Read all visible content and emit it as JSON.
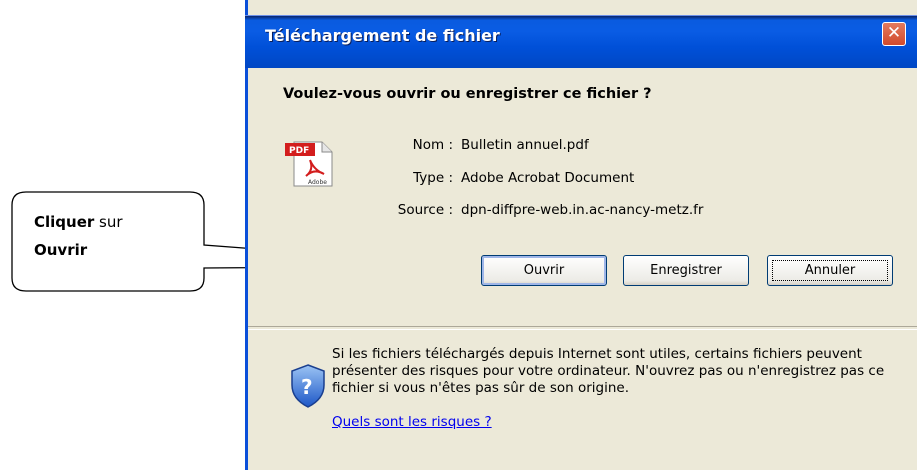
{
  "dialog": {
    "title": "Téléchargement de fichier",
    "close_glyph": "✕",
    "question": "Voulez-vous ouvrir ou enregistrer ce fichier ?",
    "file": {
      "name_label": "Nom :",
      "name_value": "Bulletin annuel.pdf",
      "type_label": "Type :",
      "type_value": "Adobe Acrobat Document",
      "source_label": "Source :",
      "source_value": "dpn-diffpre-web.in.ac-nancy-metz.fr",
      "icon": "pdf-file-icon",
      "icon_badge": "PDF",
      "icon_caption": "Adobe"
    },
    "buttons": {
      "open": "Ouvrir",
      "save": "Enregistrer",
      "cancel": "Annuler"
    },
    "warning": {
      "text": "Si les fichiers téléchargés depuis Internet sont utiles, certains fichiers peuvent présenter des risques pour votre ordinateur. N'ouvrez pas ou n'enregistrez pas ce fichier si vous n'êtes pas sûr de son origine.",
      "link": "Quels sont les risques ?",
      "icon": "shield-icon"
    }
  },
  "callout": {
    "bold1": "Cliquer",
    "text1": " sur",
    "bold2": "Ouvrir"
  },
  "colors": {
    "titlebar": "#0050d8",
    "dialog_bg": "#ece9d8",
    "close": "#d14a2c",
    "link": "#0000ee"
  }
}
